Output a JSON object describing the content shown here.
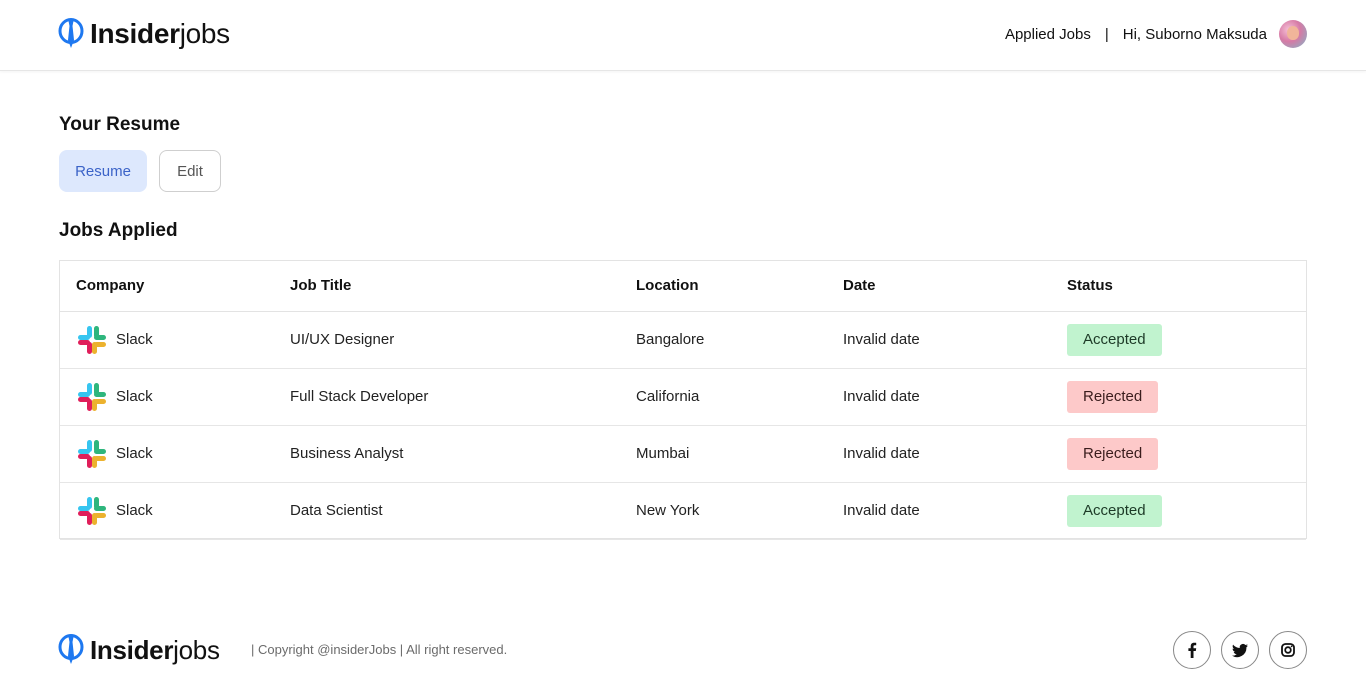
{
  "brand": {
    "bold": "Insider",
    "light": "jobs",
    "accent_color": "#1e78f0"
  },
  "nav": {
    "applied_jobs": "Applied Jobs",
    "separator": "|",
    "greeting": "Hi, Suborno Maksuda"
  },
  "resume": {
    "title": "Your Resume",
    "resume_button": "Resume",
    "edit_button": "Edit"
  },
  "jobs": {
    "title": "Jobs Applied",
    "headers": [
      "Company",
      "Job Title",
      "Location",
      "Date",
      "Status"
    ],
    "rows": [
      {
        "company": "Slack",
        "job_title": "UI/UX Designer",
        "location": "Bangalore",
        "date": "Invalid date",
        "status": "Accepted"
      },
      {
        "company": "Slack",
        "job_title": "Full Stack Developer",
        "location": "California",
        "date": "Invalid date",
        "status": "Rejected"
      },
      {
        "company": "Slack",
        "job_title": "Business Analyst",
        "location": "Mumbai",
        "date": "Invalid date",
        "status": "Rejected"
      },
      {
        "company": "Slack",
        "job_title": "Data Scientist",
        "location": "New York",
        "date": "Invalid date",
        "status": "Accepted"
      }
    ]
  },
  "footer": {
    "copyright": "| Copyright @insiderJobs | All right reserved.",
    "socials": [
      "facebook-icon",
      "twitter-icon",
      "instagram-icon"
    ]
  },
  "status_colors": {
    "Accepted": "#c1f3cf",
    "Rejected": "#fdc9c9"
  }
}
